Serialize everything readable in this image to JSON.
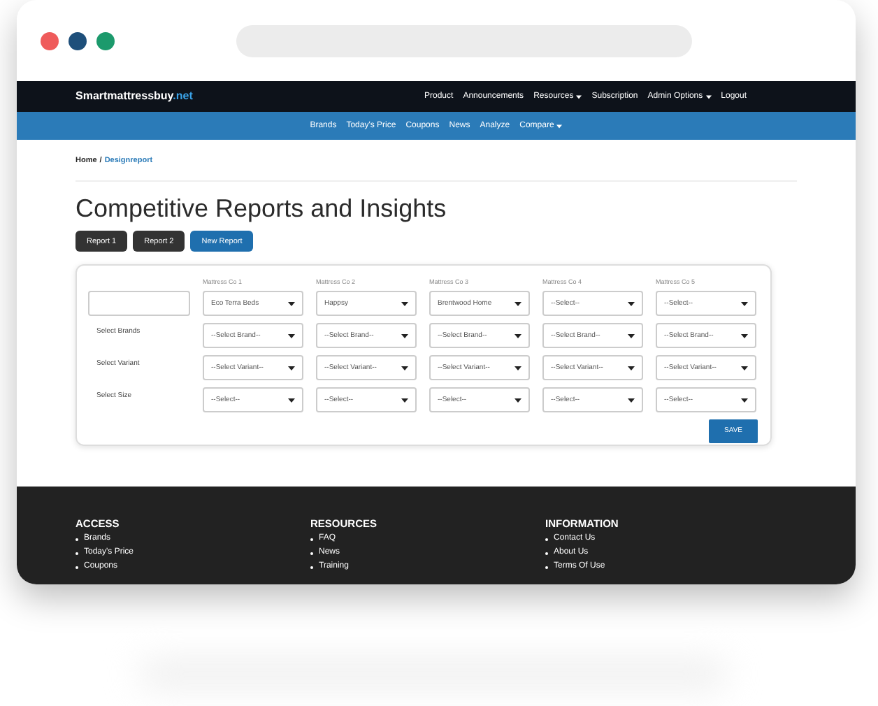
{
  "navbar": {
    "logo": {
      "main": "Smartmattressbuy",
      "suffix": ".net"
    },
    "items": [
      {
        "label": "Product",
        "has_menu": false
      },
      {
        "label": "Announcements",
        "has_menu": false
      },
      {
        "label": "Resources",
        "has_menu": true
      },
      {
        "label": "Subscription",
        "has_menu": false
      },
      {
        "label": "Admin Options",
        "has_menu": true
      },
      {
        "label": "Logout",
        "has_menu": false
      }
    ]
  },
  "subnav": {
    "items": [
      {
        "label": "Brands",
        "has_menu": false
      },
      {
        "label": "Today's Price",
        "has_menu": false
      },
      {
        "label": "Coupons",
        "has_menu": false
      },
      {
        "label": "News",
        "has_menu": false
      },
      {
        "label": "Analyze",
        "has_menu": false
      },
      {
        "label": "Compare",
        "has_menu": true
      }
    ]
  },
  "breadcrumb": {
    "separator": "/",
    "items": [
      {
        "label": "Home",
        "kind": "plain"
      },
      {
        "label": "Designreport",
        "kind": "link"
      }
    ]
  },
  "page_title": "Competitive Reports and Insights",
  "report_buttons": [
    {
      "label": "Report 1",
      "kind": "secondary"
    },
    {
      "label": "Report 2",
      "kind": "secondary"
    },
    {
      "label": "New Report",
      "kind": "primary"
    }
  ],
  "form": {
    "row_labels": [
      "Select Brands",
      "Select Variant",
      "Select Size"
    ],
    "columns": [
      {
        "label": "Mattress Co 1",
        "selects": [
          "Eco Terra Beds",
          "--Select Brand--",
          "--Select Variant--",
          "--Select--"
        ]
      },
      {
        "label": "Mattress Co 2",
        "selects": [
          "Happsy",
          "--Select Brand--",
          "--Select Variant--",
          "--Select--"
        ]
      },
      {
        "label": "Mattress Co 3",
        "selects": [
          "Brentwood Home",
          "--Select Brand--",
          "--Select Variant--",
          "--Select--"
        ]
      },
      {
        "label": "Mattress Co 4",
        "selects": [
          "--Select--",
          "--Select Brand--",
          "--Select Variant--",
          "--Select--"
        ]
      },
      {
        "label": "Mattress Co 5",
        "selects": [
          "--Select--",
          "--Select Brand--",
          "--Select Variant--",
          "--Select--"
        ]
      }
    ],
    "save_button": "SAVE"
  },
  "footer": {
    "columns": [
      {
        "heading": "ACCESS",
        "links": [
          "Brands",
          "Today's Price",
          "Coupons"
        ]
      },
      {
        "heading": "RESOURCES",
        "links": [
          "FAQ",
          "News",
          "Training"
        ]
      },
      {
        "heading": "INFORMATION",
        "links": [
          "Contact Us",
          "About Us",
          "Terms Of Use"
        ]
      }
    ]
  }
}
